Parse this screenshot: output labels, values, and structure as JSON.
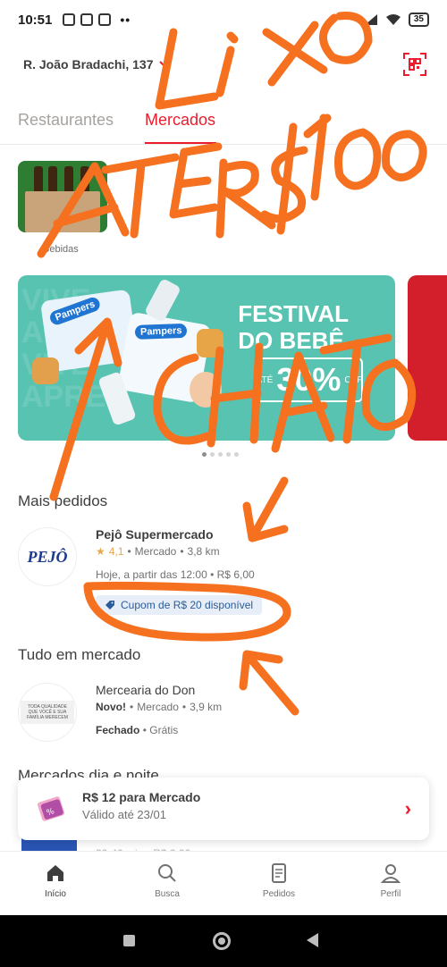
{
  "status_bar": {
    "time": "10:51",
    "battery": "35"
  },
  "header": {
    "address": "R. João Bradachi, 137"
  },
  "tabs": [
    {
      "label": "Restaurantes",
      "active": false
    },
    {
      "label": "Mercados",
      "active": true
    }
  ],
  "categories": [
    {
      "label": "Bebidas"
    }
  ],
  "banner": {
    "title_line1": "FESTIVAL",
    "title_line2": "DO BEBÊ",
    "discount_prefix": "ATÉ",
    "discount_value": "30%",
    "discount_suffix": "OFF",
    "brand": "Pampers",
    "colors": {
      "background": "#59c3b2",
      "next_banner": "#d21f2b"
    }
  },
  "sections": {
    "mais_pedidos": "Mais pedidos",
    "tudo_em_mercado": "Tudo em mercado",
    "partial_next": "Mercados dia e noite"
  },
  "stores": [
    {
      "name": "Pejô Supermercado",
      "logo_text": "PEJÔ",
      "rating": "4,1",
      "category": "Mercado",
      "distance": "3,8 km",
      "hours": "Hoje, a partir das 12:00",
      "fee": "R$ 6,00",
      "coupon": "Cupom de R$ 20 disponível"
    },
    {
      "name": "Mercearia do Don",
      "logo_text": "TODA QUALIDADE QUE VOCÊ E SUA FAMÍLIA MERECEM",
      "badge": "Novo!",
      "category": "Mercado",
      "distance": "3,9 km",
      "status": "Fechado",
      "fee": "Grátis"
    }
  ],
  "partial_meta": "30-40 min • R$ 2,00",
  "promo_card": {
    "title": "R$ 12 para Mercado",
    "subtitle": "Válido até 23/01"
  },
  "bottom_nav": [
    {
      "label": "Início",
      "icon": "home-icon",
      "active": true
    },
    {
      "label": "Busca",
      "icon": "search-icon",
      "active": false
    },
    {
      "label": "Pedidos",
      "icon": "orders-icon",
      "active": false
    },
    {
      "label": "Perfil",
      "icon": "profile-icon",
      "active": false
    }
  ],
  "annotations": {
    "color": "#f5701f",
    "line1": "LIXO",
    "line2": "ATÉ R$ 100",
    "line3": "CHATO"
  },
  "brand_colors": {
    "accent": "#ea1d2c",
    "text": "#3f3e3e",
    "muted": "#717171"
  }
}
